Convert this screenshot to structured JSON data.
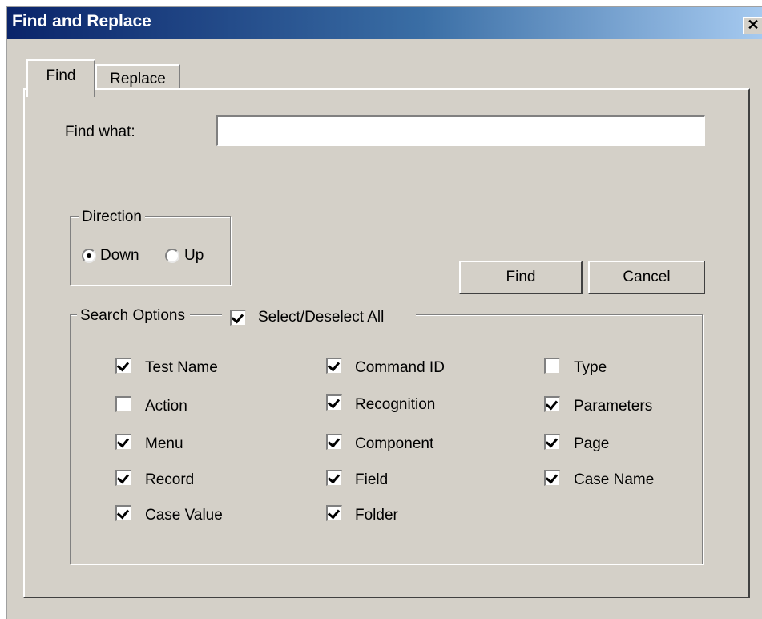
{
  "window": {
    "title": "Find and Replace",
    "close_glyph": "✕"
  },
  "tabs": [
    {
      "label": "Find",
      "selected": true
    },
    {
      "label": "Replace",
      "selected": false
    }
  ],
  "find_what": {
    "label": "Find what:",
    "value": "",
    "placeholder": ""
  },
  "direction": {
    "label": "Direction",
    "options": [
      {
        "label": "Down",
        "selected": true
      },
      {
        "label": "Up",
        "selected": false
      }
    ]
  },
  "buttons": {
    "find": "Find",
    "cancel": "Cancel"
  },
  "search_options": {
    "label": "Search Options",
    "select_all": {
      "label": "Select/Deselect All",
      "checked": true
    },
    "columns": [
      [
        {
          "label": "Test Name",
          "checked": true
        },
        {
          "label": "Action",
          "checked": false
        },
        {
          "label": "Menu",
          "checked": true
        },
        {
          "label": "Record",
          "checked": true
        },
        {
          "label": "Case Value",
          "checked": true
        }
      ],
      [
        {
          "label": "Command ID",
          "checked": true
        },
        {
          "label": "Recognition",
          "checked": true
        },
        {
          "label": "Component",
          "checked": true
        },
        {
          "label": "Field",
          "checked": true
        },
        {
          "label": "Folder",
          "checked": true
        }
      ],
      [
        {
          "label": "Type",
          "checked": false
        },
        {
          "label": "Parameters",
          "checked": true
        },
        {
          "label": "Page",
          "checked": true
        },
        {
          "label": "Case Name",
          "checked": true
        }
      ]
    ]
  },
  "colors": {
    "titlebar_start": "#0a246a",
    "titlebar_end": "#a6caf0",
    "face": "#d4d0c8"
  }
}
